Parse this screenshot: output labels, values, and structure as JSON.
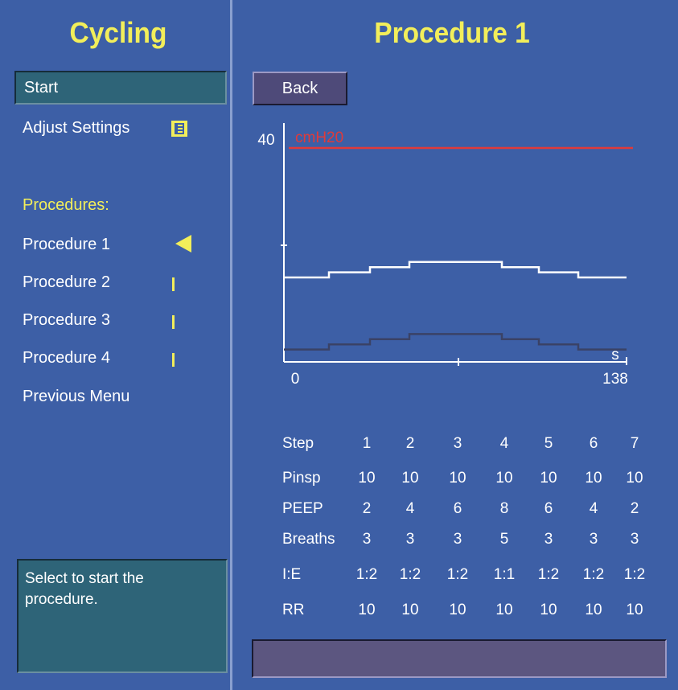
{
  "left": {
    "title": "Cycling",
    "start_label": "Start",
    "adjust_settings_label": "Adjust Settings",
    "procedures_label": "Procedures:",
    "procedures": [
      "Procedure 1",
      "Procedure 2",
      "Procedure 3",
      "Procedure 4"
    ],
    "previous_menu_label": "Previous Menu",
    "help_text": "Select to start the procedure."
  },
  "right": {
    "title": "Procedure 1",
    "back_label": "Back",
    "status_text": ""
  },
  "chart_data": {
    "type": "line",
    "y_unit": "cmH20",
    "x_unit": "s",
    "ylim": [
      0,
      40
    ],
    "xlim": [
      0,
      138
    ],
    "y_tick_labels": [
      "40"
    ],
    "x_tick_labels": [
      "0",
      "138"
    ],
    "limit_line": 40,
    "limit_color": "#e03a3a",
    "series": [
      {
        "color": "#ffffff",
        "steps": [
          0,
          16,
          42,
          68,
          132,
          158,
          182,
          230
        ],
        "values": [
          10,
          12,
          14,
          16,
          14,
          12,
          10
        ]
      },
      {
        "color": "#3a4266",
        "steps": [
          0,
          16,
          42,
          68,
          132,
          158,
          182,
          230
        ],
        "values": [
          2,
          4,
          6,
          8,
          6,
          4,
          2
        ]
      }
    ]
  },
  "table": {
    "rows": [
      {
        "label": "Step",
        "values": [
          "1",
          "2",
          "3",
          "4",
          "5",
          "6",
          "7"
        ]
      },
      {
        "label": "Pinsp",
        "values": [
          "10",
          "10",
          "10",
          "10",
          "10",
          "10",
          "10"
        ]
      },
      {
        "label": "PEEP",
        "values": [
          "2",
          "4",
          "6",
          "8",
          "6",
          "4",
          "2"
        ]
      },
      {
        "label": "Breaths",
        "values": [
          "3",
          "3",
          "3",
          "5",
          "3",
          "3",
          "3"
        ]
      },
      {
        "label": "I:E",
        "values": [
          "1:2",
          "1:2",
          "1:2",
          "1:1",
          "1:2",
          "1:2",
          "1:2"
        ]
      },
      {
        "label": "RR",
        "values": [
          "10",
          "10",
          "10",
          "10",
          "10",
          "10",
          "10"
        ]
      }
    ]
  },
  "colors": {
    "background": "#3d5fa6",
    "title": "#f2ee5a",
    "panel": "#2e6478",
    "button": "#4e4a79"
  }
}
